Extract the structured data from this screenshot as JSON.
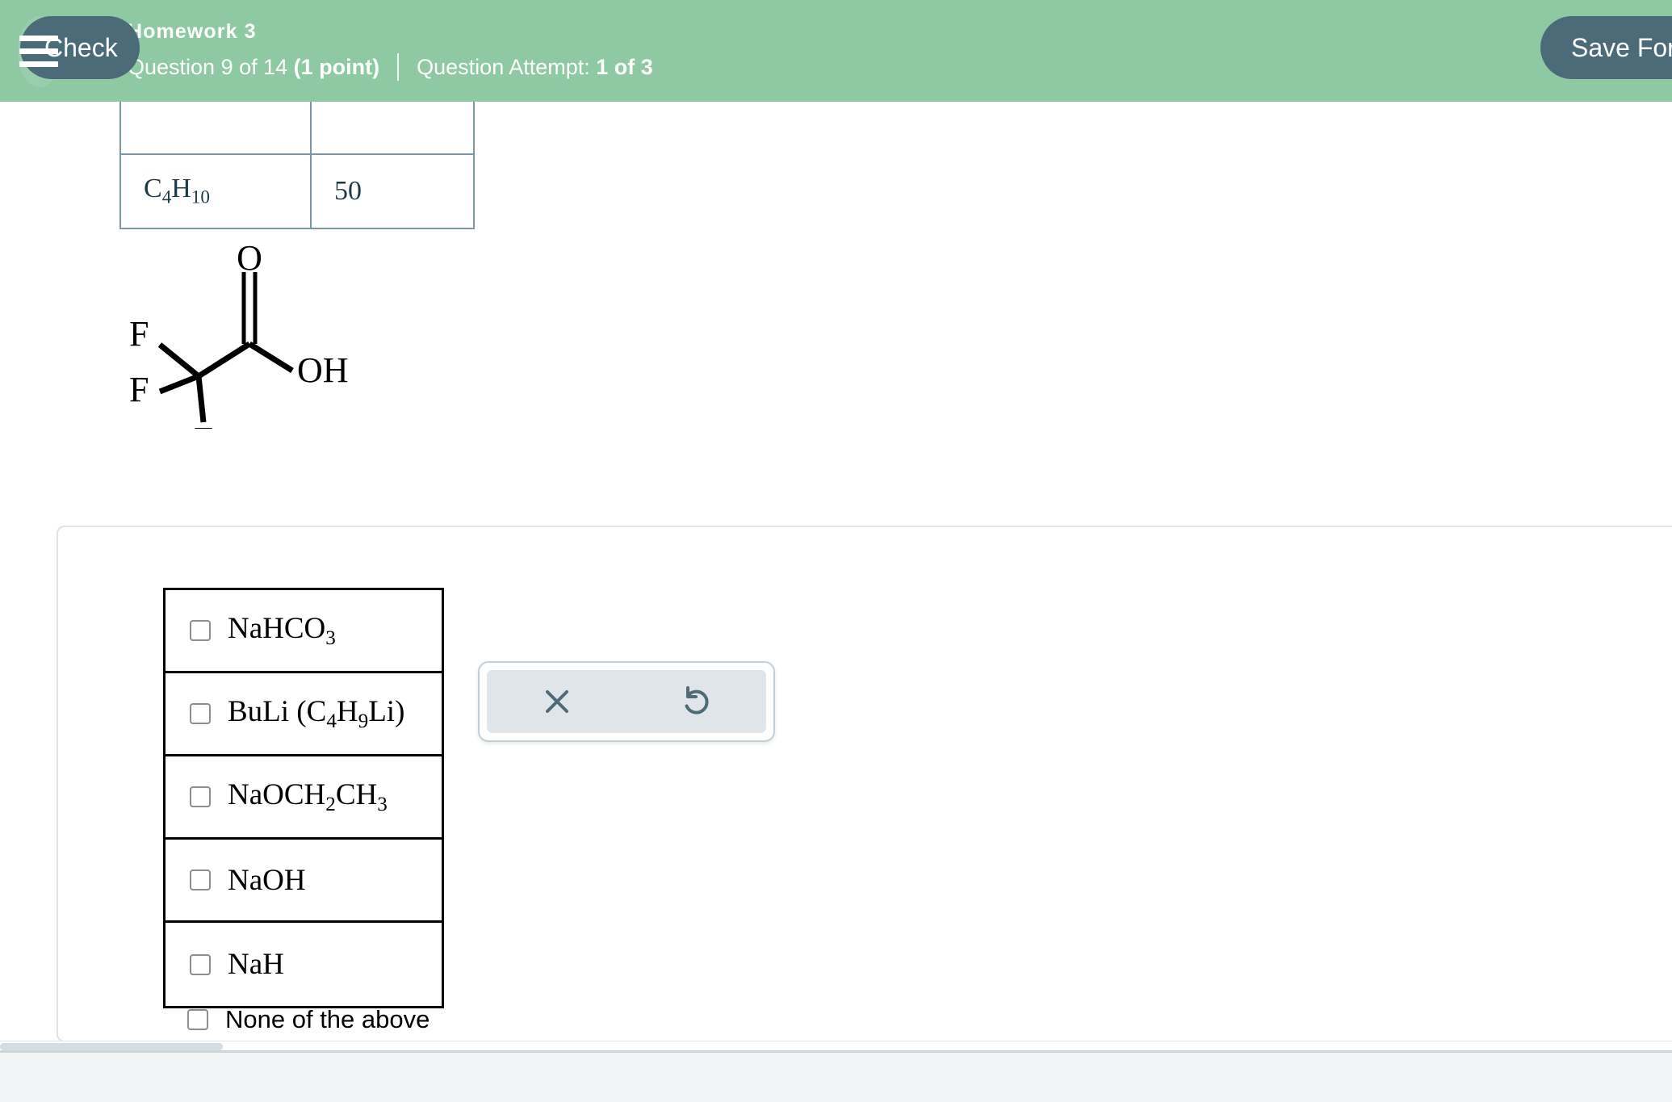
{
  "header": {
    "menu_icon": "hamburger-menu-icon",
    "assignment_title": "Homework 3",
    "question_label": "Question 9 of 14",
    "question_points": "(1 point)",
    "attempt_label": "Question Attempt:",
    "attempt_value": "1 of 3",
    "background_color": "#8ec9a3",
    "text_color": "#ffffff"
  },
  "table": {
    "rows": [
      {
        "formula_main": "C",
        "sub1": "4",
        "mid": "H",
        "sub2": "10",
        "value": "50"
      }
    ]
  },
  "molecule": {
    "name": "trifluoroacetic-acid",
    "atom_labels": {
      "oxygen_double": "O",
      "hydroxyl": "OH",
      "fluorine_upper_left": "F",
      "fluorine_lower_left": "F",
      "fluorine_bottom": "F"
    }
  },
  "answer_card": {
    "choices": [
      {
        "id": "nahco3",
        "main": "NaHCO",
        "sub": "3",
        "tail": "",
        "checked": false
      },
      {
        "id": "buli",
        "main": "BuLi (C",
        "sub": "4",
        "tail": "H",
        "sub2": "9",
        "tail2": "Li)",
        "checked": false
      },
      {
        "id": "naoch2ch3",
        "main": "NaOCH",
        "sub": "2",
        "tail": "CH",
        "sub2": "3",
        "tail2": "",
        "checked": false
      },
      {
        "id": "naoh",
        "main": "NaOH",
        "sub": "",
        "tail": "",
        "checked": false
      },
      {
        "id": "nah",
        "main": "NaH",
        "sub": "",
        "tail": "",
        "checked": false
      }
    ],
    "none_option": {
      "id": "none-of-the-above",
      "label": "None of the above",
      "checked": false
    }
  },
  "toolbar": {
    "clear_icon": "close-x-icon",
    "undo_icon": "undo-arrow-icon",
    "icon_color": "#4e6b77",
    "background_color": "#dfe5e8"
  },
  "footer": {
    "check_label": "Check",
    "save_label": "Save For L",
    "button_color": "#4c6b78",
    "background_color": "#f1f4f5"
  }
}
